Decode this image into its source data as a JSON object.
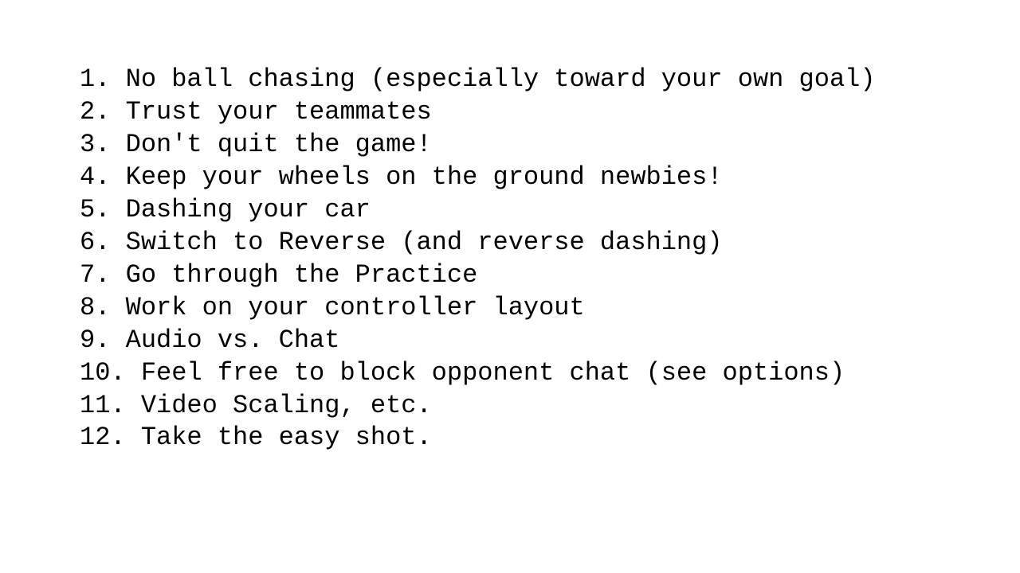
{
  "list": {
    "items": [
      {
        "number": "1.",
        "text": "No ball chasing (especially toward your own goal)"
      },
      {
        "number": "2.",
        "text": "Trust your teammates"
      },
      {
        "number": "3.",
        "text": "Don't quit the game!"
      },
      {
        "number": "4.",
        "text": "Keep your wheels on the ground newbies!"
      },
      {
        "number": "5.",
        "text": "Dashing your car"
      },
      {
        "number": "6.",
        "text": "Switch to Reverse (and reverse dashing)"
      },
      {
        "number": "7.",
        "text": "Go through the Practice"
      },
      {
        "number": "8.",
        "text": "Work on your controller layout"
      },
      {
        "number": "9.",
        "text": "Audio vs. Chat"
      },
      {
        "number": "10.",
        "text": "Feel free to block opponent chat (see options)"
      },
      {
        "number": "11.",
        "text": "Video Scaling, etc."
      },
      {
        "number": "12.",
        "text": "Take the easy shot."
      }
    ]
  }
}
